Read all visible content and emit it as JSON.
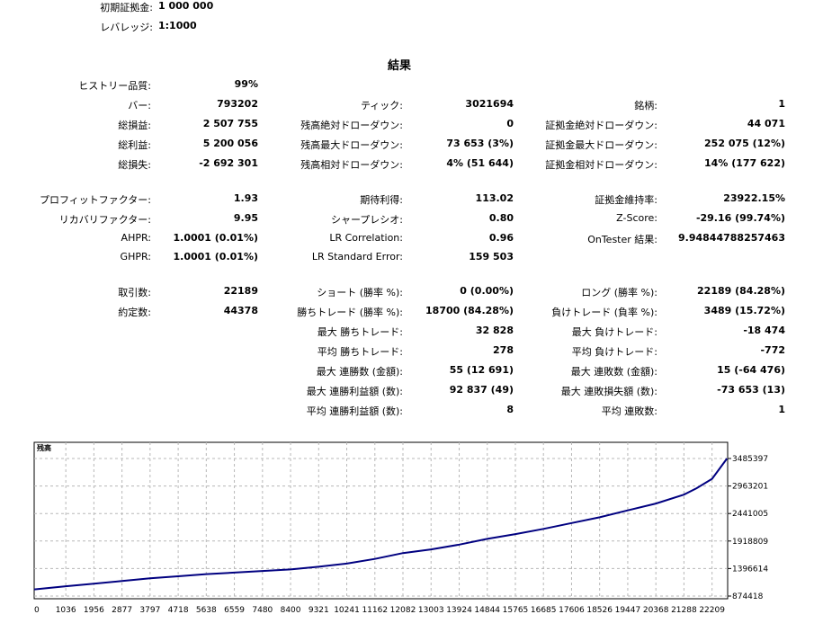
{
  "header": {
    "initial_deposit": {
      "label": "初期証拠金:",
      "value": "1 000 000"
    },
    "leverage": {
      "label": "レバレッジ:",
      "value": "1:1000"
    }
  },
  "results_title": "結果",
  "col1": [
    {
      "label": "ヒストリー品質:",
      "value": "99%"
    },
    {
      "label": "バー:",
      "value": "793202"
    },
    {
      "label": "総損益:",
      "value": "2 507 755"
    },
    {
      "label": "総利益:",
      "value": "5 200 056"
    },
    {
      "label": "総損失:",
      "value": "-2 692 301"
    },
    {
      "label": "プロフィットファクター:",
      "value": "1.93"
    },
    {
      "label": "リカバリファクター:",
      "value": "9.95"
    },
    {
      "label": "AHPR:",
      "value": "1.0001 (0.01%)"
    },
    {
      "label": "GHPR:",
      "value": "1.0001 (0.01%)"
    },
    {
      "label": "取引数:",
      "value": "22189"
    },
    {
      "label": "約定数:",
      "value": "44378"
    }
  ],
  "col2": [
    {
      "label": "ティック:",
      "value": "3021694"
    },
    {
      "label": "残高絶対ドローダウン:",
      "value": "0"
    },
    {
      "label": "残高最大ドローダウン:",
      "value": "73 653 (3%)"
    },
    {
      "label": "残高相対ドローダウン:",
      "value": "4% (51 644)"
    },
    {
      "label": "期待利得:",
      "value": "113.02"
    },
    {
      "label": "シャープレシオ:",
      "value": "0.80"
    },
    {
      "label": "LR Correlation:",
      "value": "0.96"
    },
    {
      "label": "LR Standard Error:",
      "value": "159 503"
    },
    {
      "label": "ショート (勝率 %):",
      "value": "0 (0.00%)"
    },
    {
      "label": "勝ちトレード (勝率 %):",
      "value": "18700 (84.28%)"
    },
    {
      "label": "最大 勝ちトレード:",
      "value": "32 828"
    },
    {
      "label": "平均 勝ちトレード:",
      "value": "278"
    },
    {
      "label": "最大 連勝数 (金額):",
      "value": "55 (12 691)"
    },
    {
      "label": "最大 連勝利益額 (数):",
      "value": "92 837 (49)"
    },
    {
      "label": "平均 連勝利益額 (数):",
      "value": "8"
    }
  ],
  "col3": [
    {
      "label": "銘柄:",
      "value": "1"
    },
    {
      "label": "証拠金絶対ドローダウン:",
      "value": "44 071"
    },
    {
      "label": "証拠金最大ドローダウン:",
      "value": "252 075 (12%)"
    },
    {
      "label": "証拠金相対ドローダウン:",
      "value": "14% (177 622)"
    },
    {
      "label": "証拠金維持率:",
      "value": "23922.15%"
    },
    {
      "label": "Z-Score:",
      "value": "-29.16 (99.74%)"
    },
    {
      "label": "OnTester 結果:",
      "value": "9.94844788257463"
    },
    {
      "label": "ロング (勝率 %):",
      "value": "22189 (84.28%)"
    },
    {
      "label": "負けトレード (負率 %):",
      "value": "3489 (15.72%)"
    },
    {
      "label": "最大 負けトレード:",
      "value": "-18 474"
    },
    {
      "label": "平均 負けトレード:",
      "value": "-772"
    },
    {
      "label": "最大 連敗数 (金額):",
      "value": "15 (-64 476)"
    },
    {
      "label": "最大 連敗損失額 (数):",
      "value": "-73 653 (13)"
    },
    {
      "label": "平均 連敗数:",
      "value": "1"
    }
  ],
  "chart_data": {
    "type": "line",
    "title": "残高",
    "x_ticks": [
      "0",
      "1036",
      "1956",
      "2877",
      "3797",
      "4718",
      "5638",
      "6559",
      "7480",
      "8400",
      "9321",
      "10241",
      "11162",
      "12082",
      "13003",
      "13924",
      "14844",
      "15765",
      "16685",
      "17606",
      "18526",
      "19447",
      "20368",
      "21288",
      "22209"
    ],
    "y_ticks": [
      "874418",
      "1396614",
      "1918809",
      "2441005",
      "2963201",
      "3485397"
    ],
    "xlim": [
      0,
      22720
    ],
    "ylim": [
      874418,
      3485397
    ],
    "grid": true,
    "line_color": "#000080",
    "series": [
      {
        "x": [
          0,
          1036,
          1956,
          2877,
          3797,
          4718,
          5638,
          6559,
          7480,
          8400,
          9321,
          10241,
          11162,
          12082,
          13003,
          13924,
          14844,
          15765,
          16685,
          17606,
          18526,
          19447,
          20368,
          21288,
          21700,
          22209,
          22700
        ],
        "y": [
          1000000,
          1060000,
          1110000,
          1160000,
          1210000,
          1250000,
          1290000,
          1320000,
          1350000,
          1380000,
          1430000,
          1490000,
          1580000,
          1690000,
          1760000,
          1850000,
          1960000,
          2050000,
          2150000,
          2260000,
          2370000,
          2500000,
          2630000,
          2800000,
          2920000,
          3100000,
          3485397
        ]
      }
    ]
  }
}
